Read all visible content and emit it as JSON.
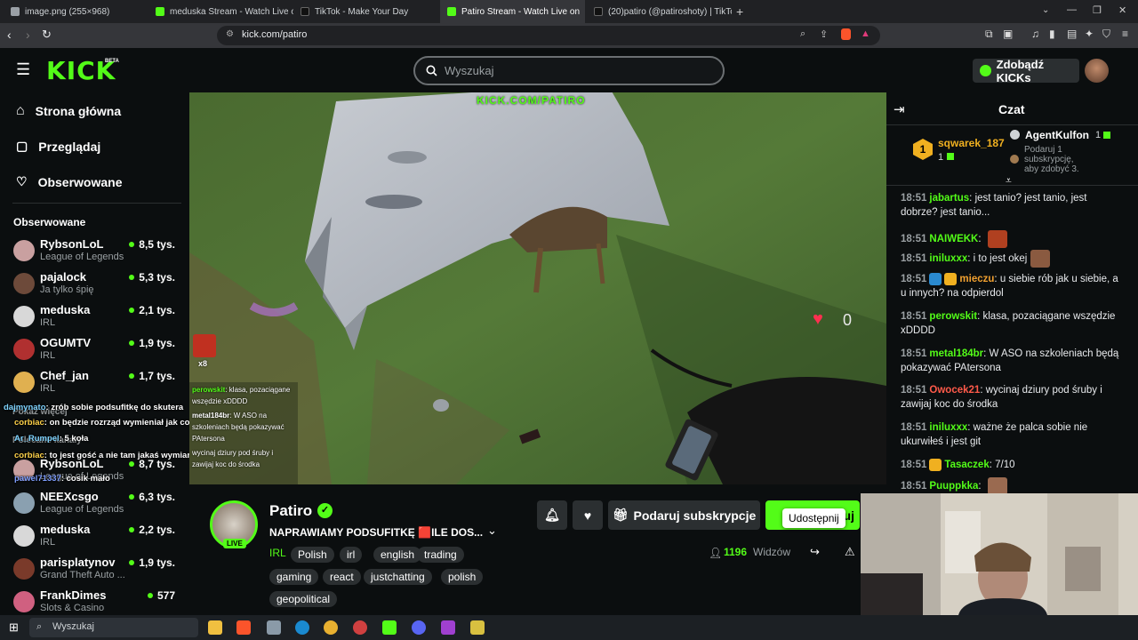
{
  "browser": {
    "tabs": [
      {
        "title": "image.png (255×968)",
        "active": false
      },
      {
        "title": "meduska Stream - Watch Live on",
        "active": false
      },
      {
        "title": "TikTok - Make Your Day",
        "active": false
      },
      {
        "title": "Patiro Stream - Watch Live on",
        "active": true
      },
      {
        "title": "(20)patiro (@patiroshoty) | TikTok",
        "active": false
      }
    ],
    "url": "kick.com/patiro"
  },
  "header": {
    "logo": "KICK",
    "logo_badge": "BETA",
    "search_placeholder": "Wyszukaj",
    "kicks_button": "Zdobądź KICKs"
  },
  "sidebar": {
    "nav": [
      {
        "label": "Strona główna",
        "icon": "home-icon"
      },
      {
        "label": "Przeglądaj",
        "icon": "browse-icon"
      },
      {
        "label": "Obserwowane",
        "icon": "heart-icon"
      }
    ],
    "followed_title": "Obserwowane",
    "followed": [
      {
        "name": "RybsonLoL",
        "category": "League of Legends",
        "viewers": "8,5 tys.",
        "color": "#c9a0a0"
      },
      {
        "name": "pajalock",
        "category": "Ja tylko śpię",
        "viewers": "5,3 tys.",
        "color": "#6d4a3a"
      },
      {
        "name": "meduska",
        "category": "IRL",
        "viewers": "2,1 tys.",
        "color": "#d8d8d8"
      },
      {
        "name": "OGUMTV",
        "category": "IRL",
        "viewers": "1,9 tys.",
        "color": "#b03030"
      },
      {
        "name": "Chef_jan",
        "category": "IRL",
        "viewers": "1,7 tys.",
        "color": "#e0b050"
      }
    ],
    "show_more": "Pokaż więcej",
    "recommended_title": "Polecane kanały",
    "recommended": [
      {
        "name": "RybsonLoL",
        "category": "League of Legends",
        "viewers": "8,7 tys.",
        "color": "#c9a0a0"
      },
      {
        "name": "NEEXcsgo",
        "category": "League of Legends",
        "viewers": "6,3 tys.",
        "color": "#8aa0b0"
      },
      {
        "name": "meduska",
        "category": "IRL",
        "viewers": "2,2 tys.",
        "color": "#d8d8d8"
      },
      {
        "name": "parisplatynov",
        "category": "Grand Theft Auto ...",
        "viewers": "1,9 tys.",
        "color": "#7a3a2a"
      },
      {
        "name": "FrankDimes",
        "category": "Slots & Casino",
        "viewers": "577",
        "color": "#d06080"
      }
    ]
  },
  "overlay_chat": [
    {
      "user": "dajmynato",
      "text": "zrób sobie podsufitkę do skutera",
      "color": "#7fd4ff"
    },
    {
      "user": "corbiac",
      "text": "on będzie rozrząd wymieniał jak coś",
      "color": "#ffd24a"
    },
    {
      "user": "Ar_Rumpel",
      "text": "5 koła",
      "color": "#7fd4ff"
    },
    {
      "user": "corbiac",
      "text": "to jest gość a nie tam jakaś wymiana oleju w romecie",
      "color": "#ffd24a"
    },
    {
      "user": "pawel71337",
      "text": "cosik mało",
      "color": "#7f9fff"
    }
  ],
  "video_overlay": {
    "watermark": "KICK.COM/PATIRO",
    "heart_count": "0",
    "emote_count": "x8",
    "chat": [
      {
        "user": "perowskit",
        "text": "klasa, pozaciągane wszędzie xDDDD",
        "color": "#53fc18"
      },
      {
        "user": "metal184br",
        "text": "W ASO na szkoleniach będą pokazywać PAtersona",
        "color": "#ffffff"
      },
      {
        "user": "",
        "text": "wycinaj dziury pod śruby i zawijaj koc do środka",
        "color": "#ffffff"
      }
    ]
  },
  "stream": {
    "streamer": "Patiro",
    "title": "NAPRAWIAMY PODSUFITKĘ 🟥ILE DOS...",
    "live_badge": "LIVE",
    "category": "IRL",
    "tags": [
      "Polish",
      "irl",
      "english",
      "trading",
      "gaming",
      "react",
      "justchatting",
      "polish",
      "geopolitical"
    ],
    "gift_sub_button": "Podaruj subskrypcje",
    "follow_button_partial": "uj",
    "tooltip": "Udostępnij",
    "viewers_count": "1196",
    "viewers_label": "Widzów"
  },
  "chat": {
    "title": "Czat",
    "pinned": {
      "rank": "1",
      "user": "sqwarek_187",
      "count": "1",
      "agent": "AgentKulfon",
      "agent_count": "1",
      "agent_note": "Podaruj 1 subskrypcję, aby zdobyć 3."
    },
    "messages": [
      {
        "time": "18:51",
        "user": "jabartus",
        "color": "#53fc18",
        "text": "jest tanio? jest tanio, jest dobrze? jest tanio...",
        "emote": ""
      },
      {
        "time": "18:51",
        "user": "NAIWEKK",
        "color": "#53fc18",
        "text": "",
        "emote": "#b04020"
      },
      {
        "time": "18:51",
        "user": "iniluxxx",
        "color": "#53fc18",
        "text": "i to jest okej",
        "emote": "#8a5a40"
      },
      {
        "time": "18:51",
        "user": "mieczu",
        "color": "#f0a030",
        "text": "u siebie rób jak u siebie, a u innych? na odpierdol",
        "emote": ""
      },
      {
        "time": "18:51",
        "user": "perowskit",
        "color": "#53fc18",
        "text": "klasa, pozaciągane wszędzie xDDDD",
        "emote": ""
      },
      {
        "time": "18:51",
        "user": "metal184br",
        "color": "#53fc18",
        "text": "W ASO na szkoleniach będą pokazywać PAtersona",
        "emote": ""
      },
      {
        "time": "18:51",
        "user": "Owocek21",
        "color": "#ff5a4a",
        "text": "wycinaj dziury pod śruby i zawijaj koc do środka",
        "emote": ""
      },
      {
        "time": "18:51",
        "user": "iniluxxx",
        "color": "#53fc18",
        "text": "ważne że palca sobie nie ukurwiłeś i jest git",
        "emote": ""
      },
      {
        "time": "18:51",
        "user": "Tasaczek",
        "color": "#53fc18",
        "text": "7/10",
        "emote": ""
      },
      {
        "time": "18:51",
        "user": "Puuppkka",
        "color": "#53fc18",
        "text": "",
        "emote": "#9a6a50"
      }
    ]
  },
  "taskbar": {
    "search_placeholder": "Wyszukaj"
  },
  "colors": {
    "brand": "#53fc18",
    "bg": "#0b0e0f",
    "surface": "#2b2f31"
  }
}
